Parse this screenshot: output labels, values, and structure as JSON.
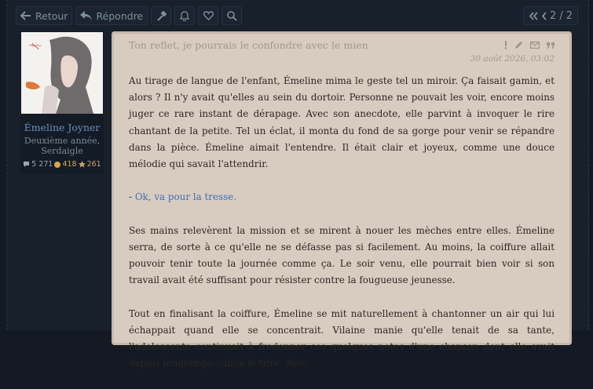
{
  "toolbar": {
    "back_label": "Retour",
    "reply_label": "Répondre",
    "icons": [
      "arrow-left-icon",
      "reply-icon",
      "tools-icon",
      "bell-icon",
      "heart-icon",
      "search-icon"
    ]
  },
  "pager": {
    "current": "2",
    "separator": "/",
    "total": "2"
  },
  "profile": {
    "name": "Émeline Joyner",
    "rank_line1": "Deuxième année,",
    "rank_line2": "Serdaigle",
    "messages": "5 271",
    "points": "418",
    "reputation": "261"
  },
  "post": {
    "title": "Ton reflet, je pourrais le confondre avec le mien",
    "date": "30 août 2026, 03:02",
    "paragraph1": "Au tirage de langue de l'enfant, Émeline mima le geste tel un miroir. Ça faisait gamin, et alors ? Il n'y avait qu'elles au sein du dortoir. Personne ne pouvait les voir, encore moins juger ce rare instant de dérapage. Avec son anecdote, elle parvint à invoquer le rire chantant de la petite. Tel un éclat, il monta du fond de sa gorge pour venir se répandre dans la pièce. Émeline aimait l'entendre. Il était clair et joyeux, comme une douce mélodie qui savait l'attendrir.",
    "dialogue_dash": "- ",
    "dialogue": "Ok, va pour la tresse.",
    "paragraph2": "Ses mains relevèrent la mission et se mirent à nouer les mèches entre elles. Émeline serra, de sorte à ce qu'elle ne se défasse pas si facilement. Au moins, la coiffure allait pouvoir tenir toute la journée comme ça. Le soir venu, elle pourrait bien voir si son travail avait été suffisant pour résister contre la fougueuse jeunesse.",
    "paragraph3": "Tout en finalisant la coiffure, Émeline se mit naturellement à chantonner un air qui lui échappait quand elle se concentrait. Vilaine manie qu'elle tenait de sa tante, l'adolescente continuait à fredonner ces quelques notes d'une chanson dont elle avait depuis longtemps oublié le titre. Avec"
  },
  "colors": {
    "background": "#141a23",
    "post_background": "#d8ccc1",
    "username": "#6a8fc0",
    "dialogue": "#3d6fb3"
  }
}
